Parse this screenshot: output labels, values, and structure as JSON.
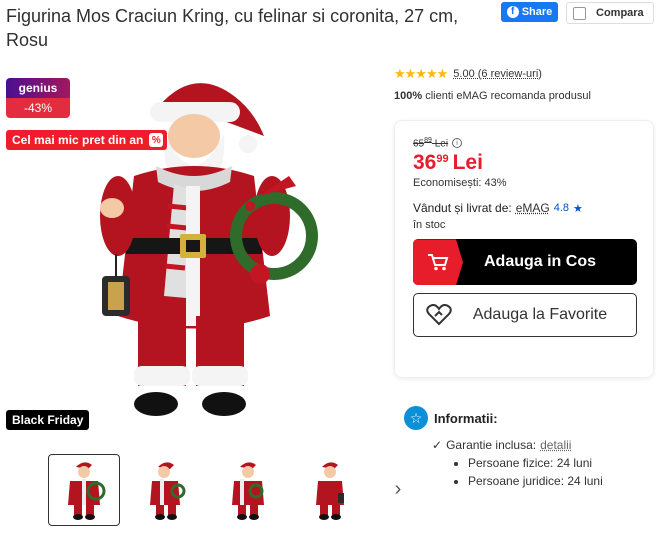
{
  "product": {
    "title": "Figurina Mos Craciun Kring, cu felinar si coronita, 27 cm, Rosu"
  },
  "actions": {
    "share_label": "Share",
    "compare_label": "Compara"
  },
  "badges": {
    "genius_label": "genius",
    "discount_label": "-43%",
    "lowest_price_label": "Cel mai mic pret din an",
    "black_friday_label": "Black Friday"
  },
  "rating": {
    "stars": 5,
    "text": "5.00 (6 review-uri)",
    "recommend_percent": "100%",
    "recommend_text": " clienti eMAG recomanda produsul"
  },
  "price": {
    "old_whole": "65",
    "old_decimals": "89",
    "old_currency": "Lei",
    "new_whole": "36",
    "new_decimals": "99",
    "new_currency": "Lei",
    "savings_label": "Economisești:",
    "savings_value": "43%"
  },
  "seller": {
    "label": "Vândut și livrat de:",
    "name": "eMAG",
    "score": "4.8"
  },
  "stock": "în stoc",
  "buttons": {
    "add_to_cart": "Adauga in Cos",
    "add_to_favorites": "Adauga la Favorite"
  },
  "info": {
    "title": "Informatii:",
    "warranty_label": "Garantie inclusa:",
    "warranty_link": "detalii",
    "warranty_items": [
      "Persoane fizice: 24 luni",
      "Persoane juridice: 24 luni"
    ]
  },
  "colors": {
    "accent_red": "#e81d2c",
    "facebook_blue": "#1877f2",
    "info_blue": "#0a8fd9",
    "seller_blue": "#0055c8",
    "star_yellow": "#f9b80a"
  }
}
